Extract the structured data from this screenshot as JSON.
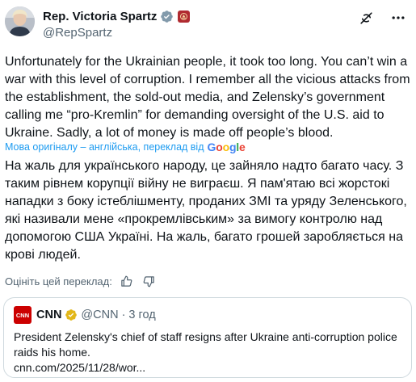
{
  "author": {
    "name": "Rep. Victoria Spartz",
    "handle": "@RepSpartz",
    "verified_icon": "verified-badge-icon",
    "affiliation_icon": "house-of-representatives-badge-icon"
  },
  "header_actions": [
    "grok-icon",
    "more-options-icon"
  ],
  "tweet": {
    "text": "Unfortunately for the Ukrainian people, it took too long. You can’t win a war with this level of corruption. I remember all the vicious attacks from the establishment, the sold-out media, and Zelensky’s government calling me “pro-Kremlin” for demanding oversight of the U.S. aid to Ukraine. Sadly, a lot of money is made off people’s blood."
  },
  "translation": {
    "meta_label": "Мова оригіналу – англійська, переклад від",
    "provider": "Google",
    "text": "На жаль для українського народу, це зайняло надто багато часу. З таким рівнем корупції війну не виграєш. Я пам'ятаю всі жорстокі нападки з боку істеблішменту, проданих ЗМІ та уряду Зеленського, які називали мене «прокремлівським» за вимогу контролю над допомогою США Україні. На жаль, багато грошей заробляється на крові людей.",
    "rate_label": "Оцініть цей переклад:"
  },
  "quote": {
    "logo_text": "CNN",
    "name": "CNN",
    "handle": "@CNN",
    "separator": "·",
    "time": "3 год",
    "text": "President Zelensky's chief of staff resigns after Ukraine anti-corruption police raids his home.",
    "link": "cnn.com/2025/11/28/wor..."
  },
  "colors": {
    "text": "#0f1419",
    "secondary": "#536471",
    "link": "#1d9bf0",
    "verified_blue": "#1d9bf0",
    "verified_gold": "#e2b719",
    "cnn_red": "#cc0000",
    "border": "#cfd9de"
  }
}
